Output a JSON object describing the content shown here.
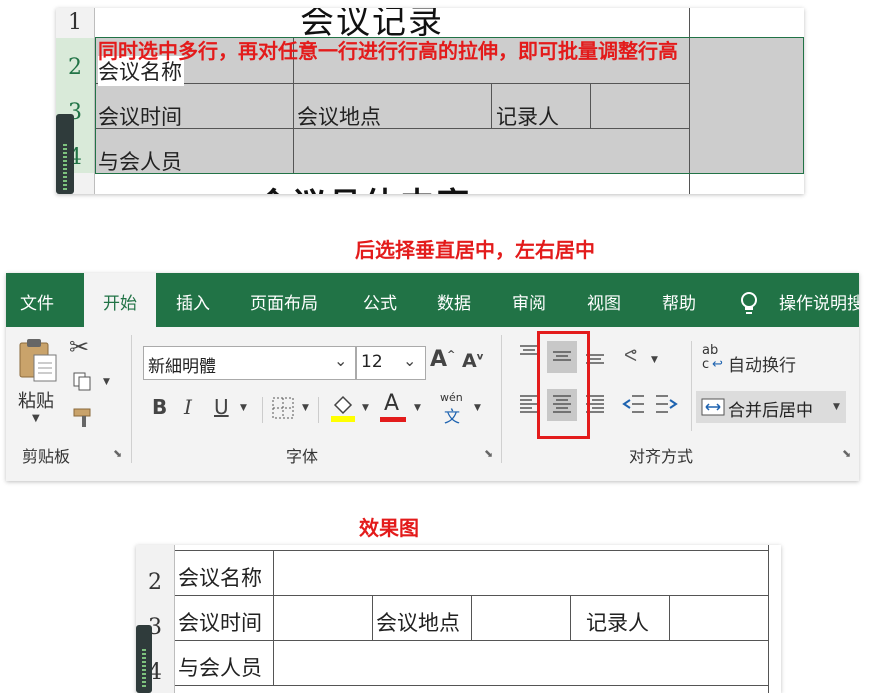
{
  "annotations": {
    "step1": "同时选中多行，再对任意一行进行行高的拉伸，即可批量调整行高",
    "step2": "后选择垂直居中，左右居中",
    "result_title": "效果图"
  },
  "sheet_top": {
    "title_partial": "会议记录",
    "body_partial": "会议具体内容",
    "row_numbers": [
      "1",
      "2",
      "3",
      "4"
    ],
    "cells": {
      "meeting_name": "会议名称",
      "meeting_time": "会议时间",
      "meeting_place": "会议地点",
      "recorder": "记录人",
      "attendees": "与会人员"
    }
  },
  "ribbon": {
    "tabs": [
      "文件",
      "开始",
      "插入",
      "页面布局",
      "公式",
      "数据",
      "审阅",
      "视图",
      "帮助",
      "操作说明搜"
    ],
    "active_tab": "开始",
    "clipboard": {
      "paste_label": "粘贴",
      "group_label": "剪贴板"
    },
    "font": {
      "font_name": "新細明體",
      "font_size": "12",
      "bold": "B",
      "italic": "I",
      "underline": "U",
      "font_color_letter": "A",
      "phonetic_top": "wén",
      "phonetic_bottom": "文",
      "grow": "A",
      "shrink": "A",
      "group_label": "字体"
    },
    "alignment": {
      "wrap_text": "自动换行",
      "merge_center": "合并后居中",
      "abc_label": "ab",
      "c_label": "c",
      "group_label": "对齐方式"
    },
    "colors": {
      "ribbon_green": "#217346",
      "highlight_red": "#e31b1b",
      "fill_yellow": "#ffff00",
      "font_red": "#e31b1b"
    }
  },
  "sheet_result": {
    "row_numbers": [
      "2",
      "3",
      "4"
    ],
    "cells": {
      "meeting_name": "会议名称",
      "meeting_time": "会议时间",
      "meeting_place": "会议地点",
      "recorder": "记录人",
      "attendees": "与会人员"
    }
  }
}
